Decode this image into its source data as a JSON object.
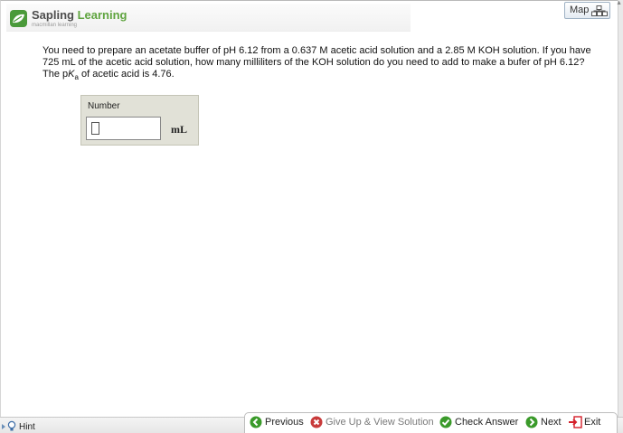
{
  "header": {
    "brand_part1": "Sapling",
    "brand_part2": "Learning",
    "tagline": "macmillan learning"
  },
  "map_button": {
    "label": "Map",
    "icon": "map-icon"
  },
  "question": {
    "text_before": "You need to prepare an acetate buffer of pH 6.12 from a 0.637 M acetic acid solution and a 2.85 M KOH solution. If you have 725 mL of the acetic acid solution, how many milliliters of the KOH solution do you need to add to make a bufer of pH 6.12? The p",
    "pk_symbol": "K",
    "pk_subscript": "a",
    "text_after": " of acetic acid is 4.76."
  },
  "answer": {
    "label": "Number",
    "value": "",
    "unit": "mL"
  },
  "footer": {
    "hint": "Hint",
    "previous": "Previous",
    "give_up": "Give Up & View Solution",
    "check_answer": "Check Answer",
    "next": "Next",
    "exit": "Exit"
  },
  "colors": {
    "brand_green": "#5fa43f",
    "nav_green": "#3a9a2a",
    "give_up_red": "#c83a3a",
    "exit_red": "#d4202a",
    "answer_box_bg": "#e1e1d7",
    "disabled_text": "#7a7a7a"
  }
}
